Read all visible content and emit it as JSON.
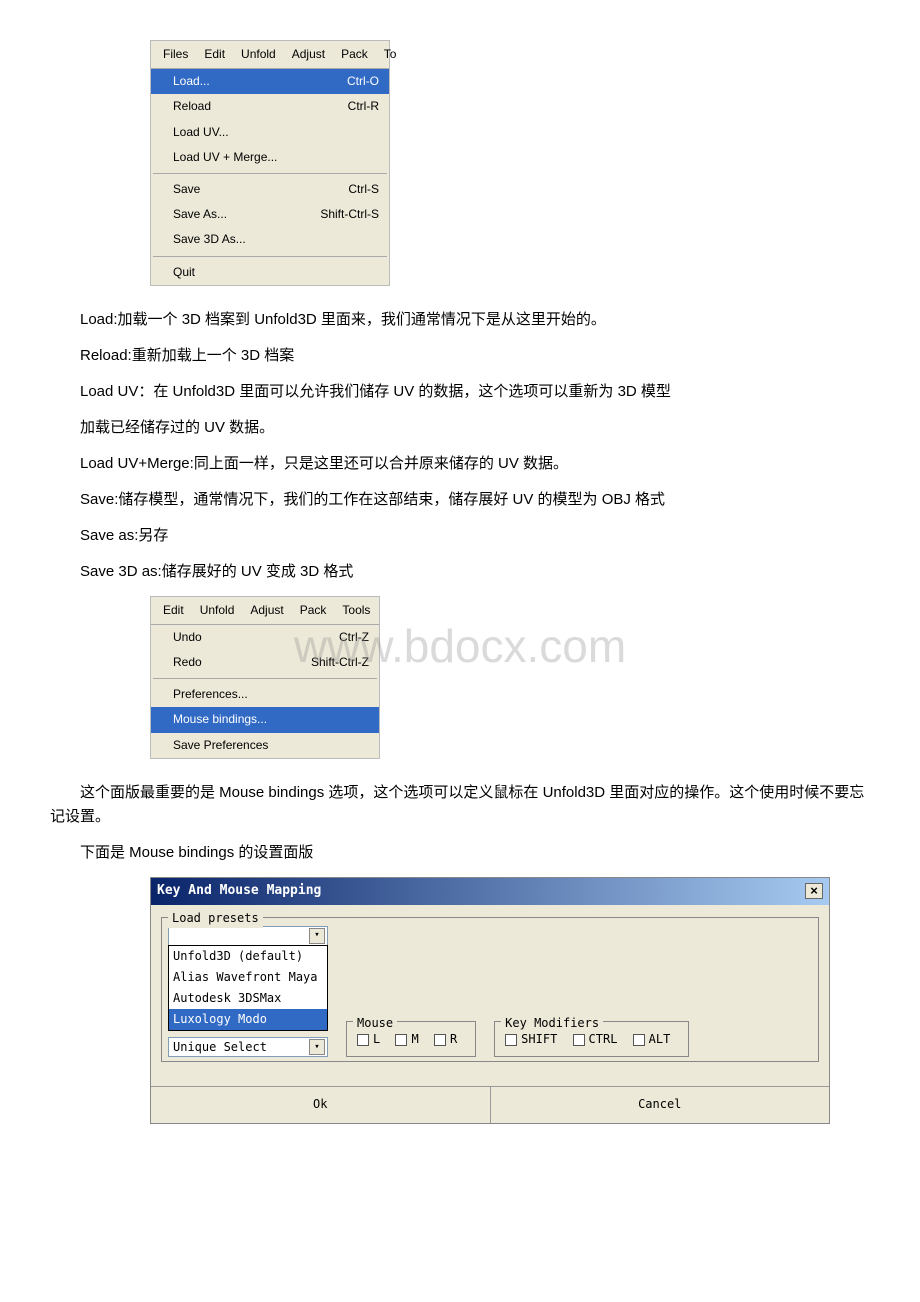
{
  "watermark": "www.bdocx.com",
  "files_menu": {
    "tabs": [
      "Files",
      "Edit",
      "Unfold",
      "Adjust",
      "Pack",
      "To"
    ],
    "items": [
      {
        "label": "Load...",
        "shortcut": "Ctrl-O",
        "hl": true
      },
      {
        "label": "Reload",
        "shortcut": "Ctrl-R"
      },
      {
        "label": "Load UV...",
        "shortcut": ""
      },
      {
        "label": "Load UV + Merge...",
        "shortcut": ""
      },
      {
        "sep": true
      },
      {
        "label": "Save",
        "shortcut": "Ctrl-S"
      },
      {
        "label": "Save As...",
        "shortcut": "Shift-Ctrl-S"
      },
      {
        "label": "Save 3D As...",
        "shortcut": ""
      },
      {
        "sep": true
      },
      {
        "label": "Quit",
        "shortcut": ""
      }
    ]
  },
  "paragraphs": {
    "p1": "Load:加载一个 3D 档案到 Unfold3D 里面来，我们通常情况下是从这里开始的。",
    "p2": "Reload:重新加载上一个 3D 档案",
    "p3": "Load UV：在 Unfold3D 里面可以允许我们储存 UV 的数据，这个选项可以重新为 3D 模型",
    "p3b": "加载已经储存过的 UV 数据。",
    "p4": "Load UV+Merge:同上面一样，只是这里还可以合并原来储存的 UV 数据。",
    "p5": "Save:储存模型，通常情况下，我们的工作在这部结束，储存展好 UV 的模型为 OBJ 格式",
    "p6": "Save as:另存",
    "p7": "Save 3D as:储存展好的 UV 变成 3D 格式",
    "p8": "这个面版最重要的是 Mouse bindings 选项，这个选项可以定义鼠标在 Unfold3D 里面对应的操作。这个使用时候不要忘记设置。",
    "p9": "下面是 Mouse bindings 的设置面版"
  },
  "edit_menu": {
    "tabs": [
      "Edit",
      "Unfold",
      "Adjust",
      "Pack",
      "Tools"
    ],
    "items": [
      {
        "label": "Undo",
        "shortcut": "Ctrl-Z"
      },
      {
        "label": "Redo",
        "shortcut": "Shift-Ctrl-Z"
      },
      {
        "sep": true
      },
      {
        "label": "Preferences...",
        "shortcut": ""
      },
      {
        "label": "Mouse bindings...",
        "shortcut": "",
        "hl": true
      },
      {
        "label": "Save Preferences",
        "shortcut": ""
      }
    ]
  },
  "dialog": {
    "title": "Key And Mouse Mapping",
    "load_presets_label": "Load presets",
    "preset_options": [
      "Unfold3D (default)",
      "Alias Wavefront Maya",
      "Autodesk 3DSMax",
      "Luxology Modo"
    ],
    "unique_select": "Unique Select",
    "mouse_label": "Mouse",
    "mouse_L": "L",
    "mouse_M": "M",
    "mouse_R": "R",
    "key_mod_label": "Key Modifiers",
    "key_shift": "SHIFT",
    "key_ctrl": "CTRL",
    "key_alt": "ALT",
    "ok": "Ok",
    "cancel": "Cancel"
  }
}
